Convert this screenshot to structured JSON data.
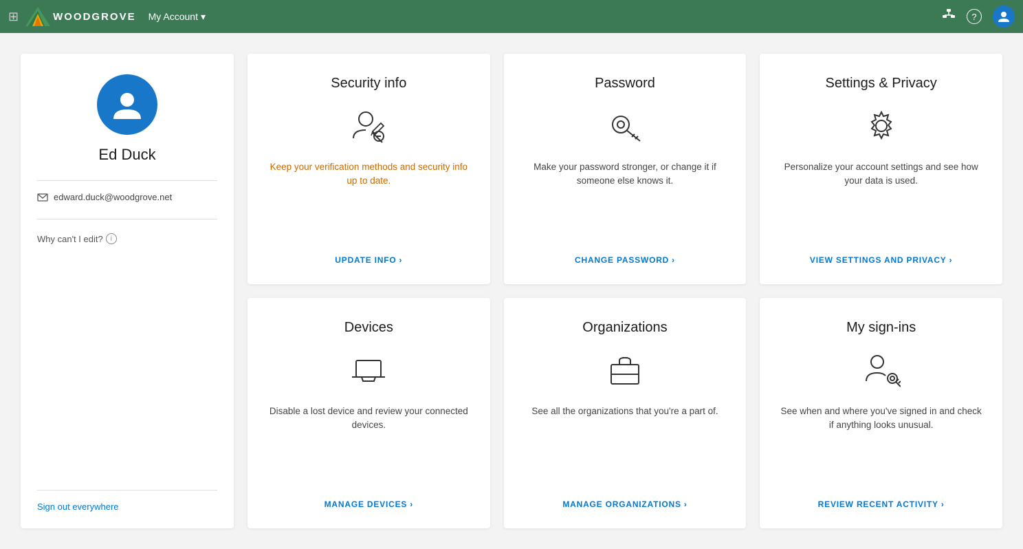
{
  "topnav": {
    "logo_text": "WOODGROVE",
    "my_account_label": "My Account",
    "chevron": "▾",
    "help_icon": "?",
    "org_icon": "⊞"
  },
  "profile": {
    "name": "Ed Duck",
    "email": "edward.duck@woodgrove.net",
    "why_cant_edit": "Why can't I edit?",
    "sign_out_everywhere": "Sign out everywhere"
  },
  "cards": [
    {
      "id": "security-info",
      "title": "Security info",
      "description": "Keep your verification methods and security info up to date.",
      "description_class": "orange",
      "link_label": "UPDATE INFO",
      "link_arrow": "›"
    },
    {
      "id": "password",
      "title": "Password",
      "description": "Make your password stronger, or change it if someone else knows it.",
      "description_class": "",
      "link_label": "CHANGE PASSWORD",
      "link_arrow": "›"
    },
    {
      "id": "settings-privacy",
      "title": "Settings & Privacy",
      "description": "Personalize your account settings and see how your data is used.",
      "description_class": "",
      "link_label": "VIEW SETTINGS AND PRIVACY",
      "link_arrow": "›"
    },
    {
      "id": "devices",
      "title": "Devices",
      "description": "Disable a lost device and review your connected devices.",
      "description_class": "",
      "link_label": "MANAGE DEVICES",
      "link_arrow": "›"
    },
    {
      "id": "organizations",
      "title": "Organizations",
      "description": "See all the organizations that you're a part of.",
      "description_class": "",
      "link_label": "MANAGE ORGANIZATIONS",
      "link_arrow": "›"
    },
    {
      "id": "my-sign-ins",
      "title": "My sign-ins",
      "description": "See when and where you've signed in and check if anything looks unusual.",
      "description_class": "",
      "link_label": "REVIEW RECENT ACTIVITY",
      "link_arrow": "›"
    }
  ],
  "colors": {
    "nav_bg": "#3c7a56",
    "accent_blue": "#0078d4",
    "avatar_blue": "#1877c8"
  }
}
